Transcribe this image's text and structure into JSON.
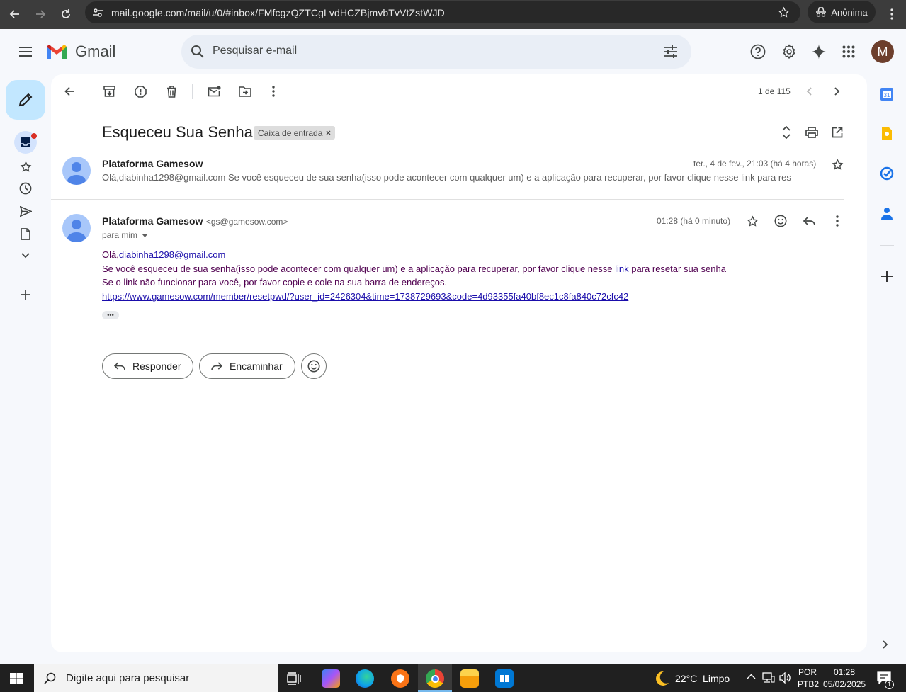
{
  "browser": {
    "url": "mail.google.com/mail/u/0/#inbox/FMfcgzQZTCgLvdHCZBjmvbTvVtZstWJD",
    "profile_label": "Anônima"
  },
  "gmail": {
    "product_name": "Gmail",
    "search_placeholder": "Pesquisar e-mail",
    "avatar_initial": "M"
  },
  "toolbar": {
    "pager": "1 de 115"
  },
  "thread": {
    "subject": "Esqueceu Sua Senha",
    "label": "Caixa de entrada",
    "collapsed_message": {
      "sender": "Plataforma Gamesow",
      "date": "ter., 4 de fev., 21:03 (há 4 horas)",
      "snippet": "Olá,diabinha1298@gmail.com Se você esqueceu de sua senha(isso pode acontecer com qualquer um) e a aplicação para recuperar, por favor clique nesse link para res"
    },
    "expanded_message": {
      "sender": "Plataforma Gamesow",
      "sender_email": "<gs@gamesow.com>",
      "recipient": "para mim",
      "time": "01:28 (há 0 minuto)",
      "greeting": "Olá,",
      "greeting_email": "diabinha1298@gmail.com",
      "line1_before": "Se você esqueceu de sua senha(isso pode acontecer com qualquer um) e a aplicação para recuperar, por favor clique nesse ",
      "line1_link": "link",
      "line1_after": " para resetar sua senha",
      "line2": "Se o link não funcionar para você, por favor copie e cole na sua barra de endereços.",
      "reset_url": "https://www.gamesow.com/member/resetpwd/?user_id=2426304&time=1738729693&code=4d93355fa40bf8ec1c8fa840c72cfc42",
      "ellipsis": "•••"
    },
    "reply_label": "Responder",
    "forward_label": "Encaminhar"
  },
  "taskbar": {
    "search_placeholder": "Digite aqui para pesquisar",
    "weather": "22°C  Limpo",
    "lang_top": "POR",
    "lang_bottom": "PTB2",
    "clock_time": "01:28",
    "clock_date": "05/02/2025",
    "notif_count": "1"
  }
}
